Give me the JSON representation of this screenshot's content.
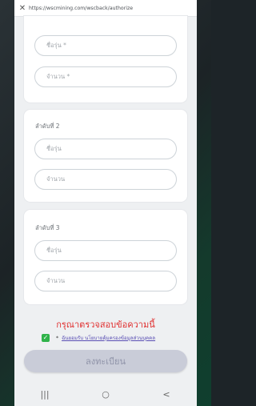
{
  "browser": {
    "url": "https://wscmining.com/wscback/authorize"
  },
  "cards": [
    {
      "title": "",
      "fields": [
        {
          "placeholder": "ชื่อรุ่น *"
        },
        {
          "placeholder": "จำนวน *"
        }
      ]
    },
    {
      "title": "ลำดับที่ 2",
      "fields": [
        {
          "placeholder": "ชื่อรุ่น"
        },
        {
          "placeholder": "จำนวน"
        }
      ]
    },
    {
      "title": "ลำดับที่ 3",
      "fields": [
        {
          "placeholder": "ชื่อรุ่น"
        },
        {
          "placeholder": "จำนวน"
        }
      ]
    }
  ],
  "validation_message": "กรุณาตรวจสอบข้อความนี้",
  "consent": {
    "checked": true,
    "required_mark": "*",
    "text": "ฉันยอมรับ นโยบายคุ้มครองข้อมูลส่วนบุคคล"
  },
  "submit_label": "ลงทะเบียน",
  "navbar": {
    "recents": "|||",
    "home": "○",
    "back": "<"
  },
  "colors": {
    "error": "#e03030",
    "checkbox": "#2fb34a",
    "link": "#5a4fb4",
    "button_bg": "#c9ccd8"
  }
}
